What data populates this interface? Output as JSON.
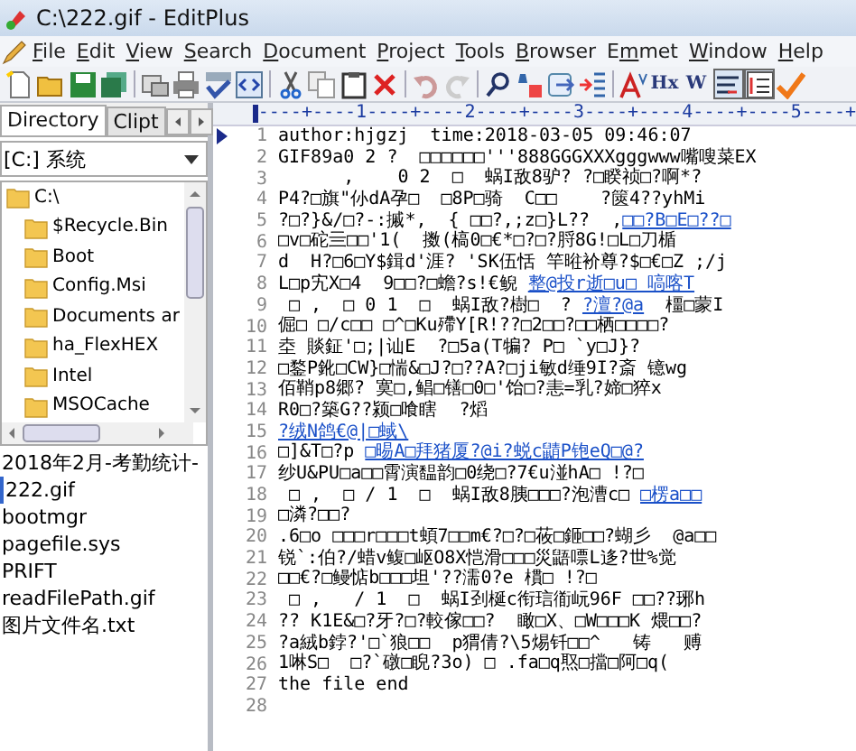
{
  "window": {
    "title": "C:\\222.gif - EditPlus"
  },
  "menu": [
    {
      "key": "F",
      "post": "ile"
    },
    {
      "key": "E",
      "post": "dit"
    },
    {
      "key": "V",
      "post": "iew"
    },
    {
      "key": "S",
      "post": "earch"
    },
    {
      "key": "D",
      "post": "ocument"
    },
    {
      "key": "P",
      "post": "roject"
    },
    {
      "key": "T",
      "post": "ools"
    },
    {
      "key": "B",
      "post": "rowser"
    },
    {
      "pre": "E",
      "key": "m",
      "post": "met"
    },
    {
      "key": "W",
      "post": "indow"
    },
    {
      "key": "H",
      "post": "elp"
    }
  ],
  "toolbar": [
    {
      "kind": "new",
      "pressed": false
    },
    {
      "kind": "open",
      "pressed": false
    },
    {
      "kind": "save",
      "pressed": false
    },
    {
      "kind": "saveall",
      "pressed": false
    },
    {
      "kind": "sep"
    },
    {
      "kind": "preview",
      "pressed": false
    },
    {
      "kind": "print",
      "pressed": false
    },
    {
      "kind": "spell",
      "pressed": false
    },
    {
      "kind": "browser",
      "pressed": false
    },
    {
      "kind": "sep"
    },
    {
      "kind": "cut",
      "pressed": false
    },
    {
      "kind": "copy",
      "pressed": false
    },
    {
      "kind": "paste",
      "pressed": false
    },
    {
      "kind": "delete",
      "pressed": false
    },
    {
      "kind": "sep"
    },
    {
      "kind": "undo",
      "pressed": false
    },
    {
      "kind": "redo",
      "pressed": false
    },
    {
      "kind": "sep"
    },
    {
      "kind": "find",
      "pressed": false
    },
    {
      "kind": "replace",
      "pressed": false
    },
    {
      "kind": "goto",
      "pressed": false
    },
    {
      "kind": "indent",
      "pressed": false
    },
    {
      "kind": "sep"
    },
    {
      "kind": "font",
      "pressed": false
    },
    {
      "kind": "text",
      "label": "Hx",
      "pressed": false
    },
    {
      "kind": "text",
      "label": "W",
      "pressed": false
    },
    {
      "kind": "wrap",
      "pressed": true
    },
    {
      "kind": "linenum",
      "pressed": true
    },
    {
      "kind": "check",
      "pressed": false
    }
  ],
  "sidebar": {
    "tabs": [
      {
        "label": "Directory",
        "selected": true
      },
      {
        "label": "Clipt",
        "selected": false
      }
    ],
    "drive": "[C:] 系统",
    "folders": [
      {
        "name": "C:\\",
        "children": [
          {
            "name": "$Recycle.Bin"
          },
          {
            "name": "Boot"
          },
          {
            "name": "Config.Msi"
          },
          {
            "name": "Documents ar"
          },
          {
            "name": "ha_FlexHEX"
          },
          {
            "name": "Intel"
          },
          {
            "name": "MSOCache"
          }
        ]
      }
    ],
    "files": [
      {
        "name": "2018年2月-考勤统计-",
        "selected": false
      },
      {
        "name": "222.gif",
        "selected": true
      },
      {
        "name": "bootmgr",
        "selected": false
      },
      {
        "name": "pagefile.sys",
        "selected": false
      },
      {
        "name": "PRIFT",
        "selected": false
      },
      {
        "name": "readFilePath.gif",
        "selected": false
      },
      {
        "name": "图片文件名.txt",
        "selected": false
      }
    ]
  },
  "editor": {
    "ruler": "----+----1----+----2----+----3----+----4----+----5----+",
    "lines": [
      {
        "number": "1",
        "current": true,
        "parts": [
          {
            "text": "author:hjgzj  time:2018-03-05 09:46:07",
            "link": false
          }
        ]
      },
      {
        "number": "2",
        "current": false,
        "parts": [
          {
            "text": "GIF89a0 2 ?  □□□□□□'''888GGGXXXgggwww嘴嗖菜EX",
            "link": false
          }
        ]
      },
      {
        "number": "3",
        "current": false,
        "parts": [
          {
            "text": "      ,    0 2  □  蜗I敌8驴? ?□睽祯□?啊*?",
            "link": false
          }
        ]
      },
      {
        "number": "4",
        "current": false,
        "parts": [
          {
            "text": "P4?□旗\"仦dA孕□  □8P□骑  C□□    ?篋4??yhMi",
            "link": false
          }
        ]
      },
      {
        "number": "5",
        "current": false,
        "parts": [
          {
            "text": "?□?}&/□?-:摵*,  { □□?,;z□}L??  ,",
            "link": false
          },
          {
            "text": "□□?B□E□??□",
            "link": true
          }
        ]
      },
      {
        "number": "6",
        "current": false,
        "parts": [
          {
            "text": "□v□砣亖□□'1(  擞(槁0□€*□?□?脟8G!□L□刀楯",
            "link": false
          }
        ]
      },
      {
        "number": "7",
        "current": false,
        "parts": [
          {
            "text": "d  H?□6□Y$鍓d'涯? 'SK伍恬 竿暀衸尊?$□€□Z ;/j",
            "link": false
          }
        ]
      },
      {
        "number": "8",
        "current": false,
        "parts": [
          {
            "text": "L□p宄X□4  9□□?□蟾?s!€鲵 ",
            "link": false
          },
          {
            "text": "整@投r逝□u□  嗃喀T",
            "link": true
          }
        ]
      },
      {
        "number": "9",
        "current": false,
        "parts": [
          {
            "text": " □ ,  □ 0 1  □  蜗I敌?樹□  ? ",
            "link": false
          },
          {
            "text": "?澶?@a",
            "link": true
          },
          {
            "text": "  橿□蒙I",
            "link": false
          }
        ]
      },
      {
        "number": "10",
        "current": false,
        "parts": [
          {
            "text": "倔□ □/c□□ □^□Ku殢Y[R!??□2□□?□□栖□□□□?",
            "link": false
          }
        ]
      },
      {
        "number": "11",
        "current": false,
        "parts": [
          {
            "text": "坴 賧鉦'□;|讪E  ?□5a(T犏? P□ `y□J}?",
            "link": false
          }
        ]
      },
      {
        "number": "12",
        "current": false,
        "parts": [
          {
            "text": "□鍪P鈋□CW}□惴&□J?□??A?□ji敏d缍9I?斎 镱wg",
            "link": false
          }
        ]
      },
      {
        "number": "13",
        "current": false,
        "parts": [
          {
            "text": "佰鞘p8郷? 寞□,鲳□䦅□0□'饴□?恚=乳?媂□猝x",
            "link": false
          }
        ]
      },
      {
        "number": "14",
        "current": false,
        "parts": [
          {
            "text": "R0□?築G??颍□喰瞎  ?熖",
            "link": false
          }
        ]
      },
      {
        "number": "15",
        "current": false,
        "parts": [
          {
            "text": "?绒N鸽€@|□蜮\\",
            "link": true
          }
        ]
      },
      {
        "number": "16",
        "current": false,
        "parts": [
          {
            "text": "□]&T□?p ",
            "link": false
          },
          {
            "text": "□晹A□拜猪厦?@i?蜕c鼱P铇eQ□@?",
            "link": true
          }
        ]
      },
      {
        "number": "17",
        "current": false,
        "parts": [
          {
            "text": "纱U&PU□a□□霄演馧韵□0绕□?7€u湴hA□ !?□",
            "link": false
          }
        ]
      },
      {
        "number": "18",
        "current": false,
        "parts": [
          {
            "text": " □ ,  □ / 1  □  蜗I敌8胰□□□?泡漕c□ ",
            "link": false
          },
          {
            "text": "□楞a□□",
            "link": true
          }
        ]
      },
      {
        "number": "19",
        "current": false,
        "parts": [
          {
            "text": "□潾?□□?",
            "link": false
          }
        ]
      },
      {
        "number": "20",
        "current": false,
        "parts": [
          {
            "text": ".6□o □□□r□□□t蝢7□□m€?□?□莜□鉔□□?蝴彡  @a□□",
            "link": false
          }
        ]
      },
      {
        "number": "21",
        "current": false,
        "parts": [
          {
            "text": "锐`:伯?/蜡v鳆□岖O8X恺滑□□□災鼯嘌L迻?世%觉",
            "link": false
          }
        ]
      },
      {
        "number": "22",
        "current": false,
        "parts": [
          {
            "text": "□□€?□鳗惦b□□□坦'??濡0?e 樌□ !?□",
            "link": false
          }
        ]
      },
      {
        "number": "23",
        "current": false,
        "parts": [
          {
            "text": " □ ,   / 1  □  蜗I刭梴c衔琂衜岏96F □□??琊h",
            "link": false
          }
        ]
      },
      {
        "number": "24",
        "current": false,
        "parts": [
          {
            "text": "?? K1E&□?牙?□?較傢□□?  瞰□X、□W□□□K 煨□□?",
            "link": false
          }
        ]
      },
      {
        "number": "25",
        "current": false,
        "parts": [
          {
            "text": "?a絨b鋍?'□`狼□□  p猬倩?\\5焬钎□□^   铸   赙",
            "link": false
          }
        ]
      },
      {
        "number": "26",
        "current": false,
        "parts": [
          {
            "text": "1啉S□  □?`礅□睨?3o) □ .fa□q焣□擋□阿□q(",
            "link": false
          }
        ]
      },
      {
        "number": "27",
        "current": false,
        "parts": [
          {
            "text": "the file end",
            "link": false
          }
        ]
      },
      {
        "number": "28",
        "current": false
      }
    ]
  }
}
